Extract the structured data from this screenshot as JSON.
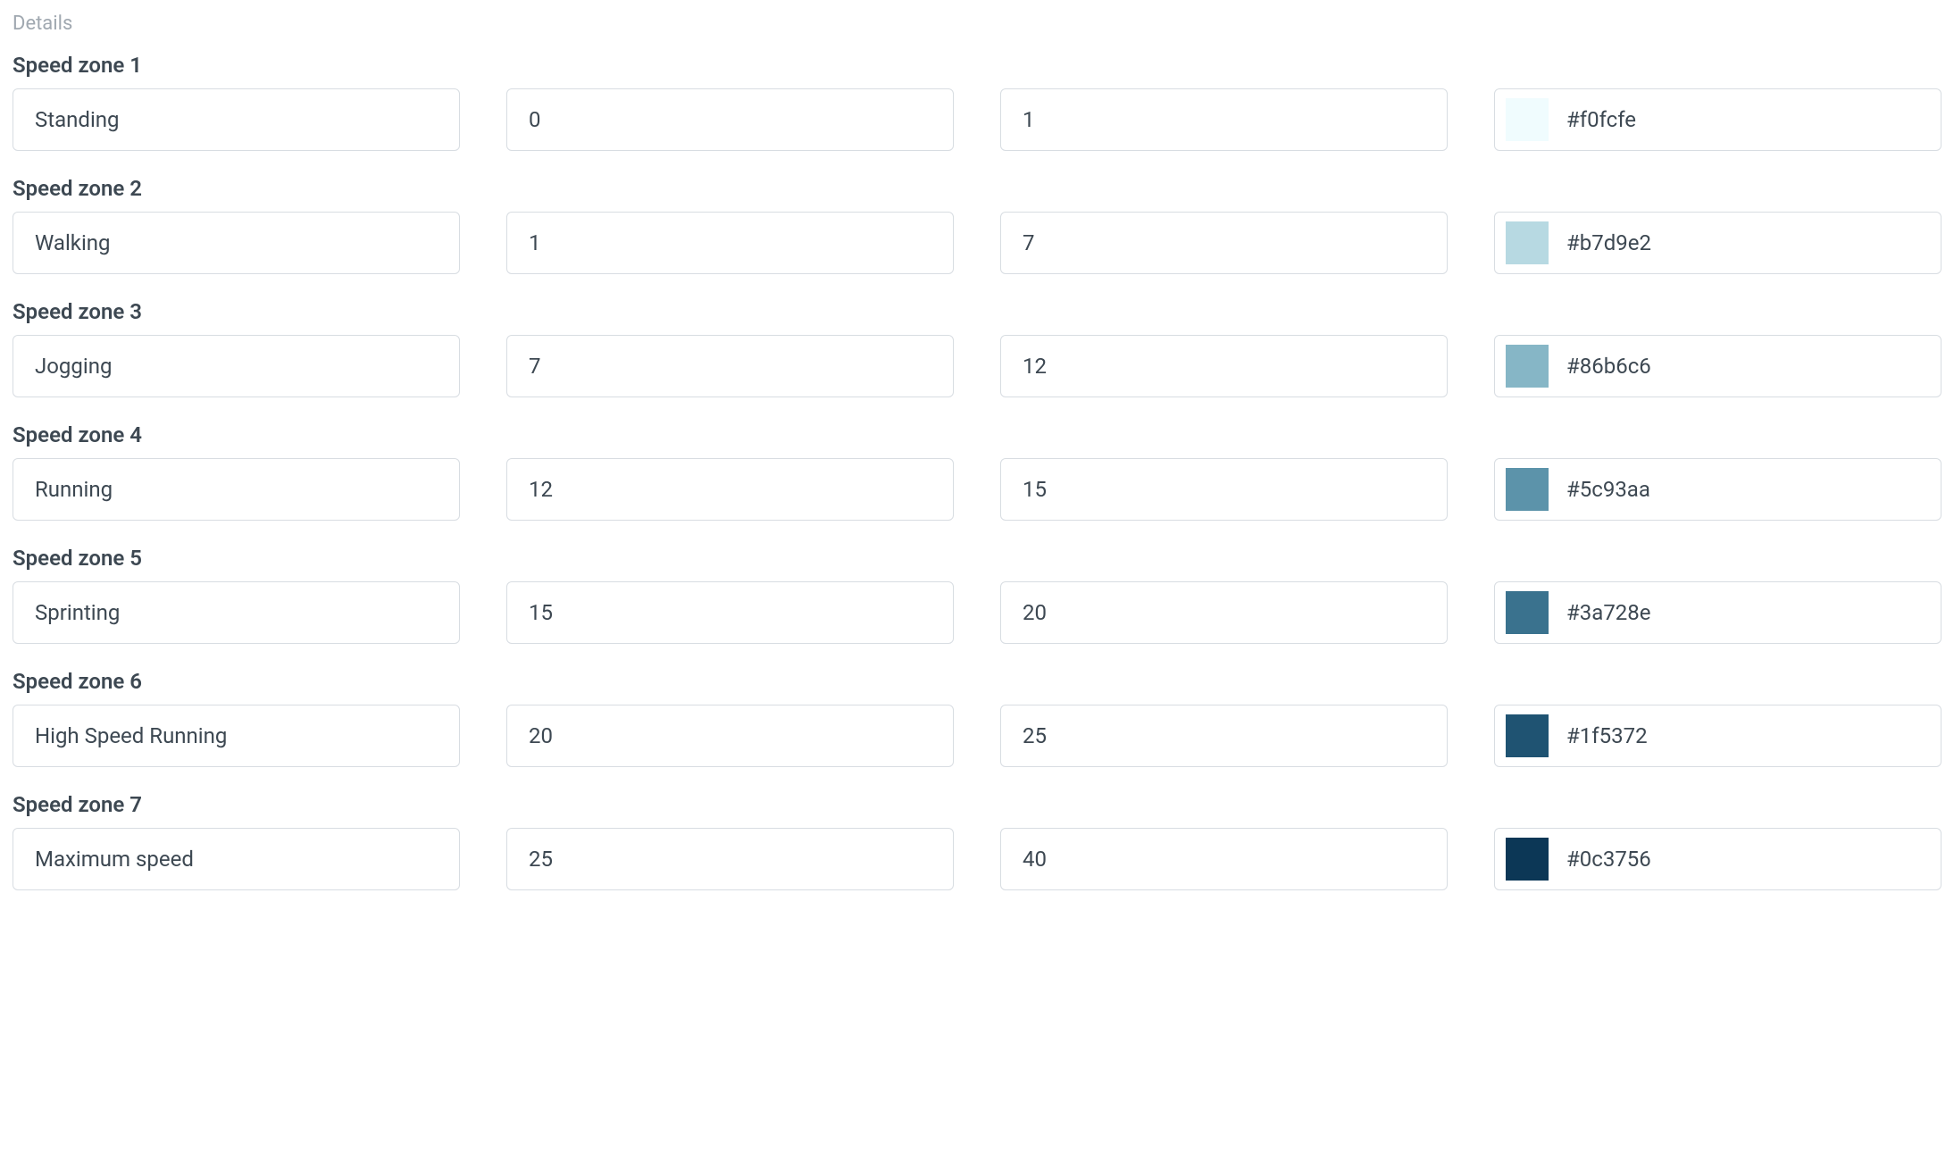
{
  "section_header": "Details",
  "zones": [
    {
      "label": "Speed zone 1",
      "name": "Standing",
      "min": "0",
      "max": "1",
      "color": "#f0fcfe"
    },
    {
      "label": "Speed zone 2",
      "name": "Walking",
      "min": "1",
      "max": "7",
      "color": "#b7d9e2"
    },
    {
      "label": "Speed zone 3",
      "name": "Jogging",
      "min": "7",
      "max": "12",
      "color": "#86b6c6"
    },
    {
      "label": "Speed zone 4",
      "name": "Running",
      "min": "12",
      "max": "15",
      "color": "#5c93aa"
    },
    {
      "label": "Speed zone 5",
      "name": "Sprinting",
      "min": "15",
      "max": "20",
      "color": "#3a728e"
    },
    {
      "label": "Speed zone 6",
      "name": "High Speed Running",
      "min": "20",
      "max": "25",
      "color": "#1f5372"
    },
    {
      "label": "Speed zone 7",
      "name": "Maximum speed",
      "min": "25",
      "max": "40",
      "color": "#0c3756"
    }
  ]
}
